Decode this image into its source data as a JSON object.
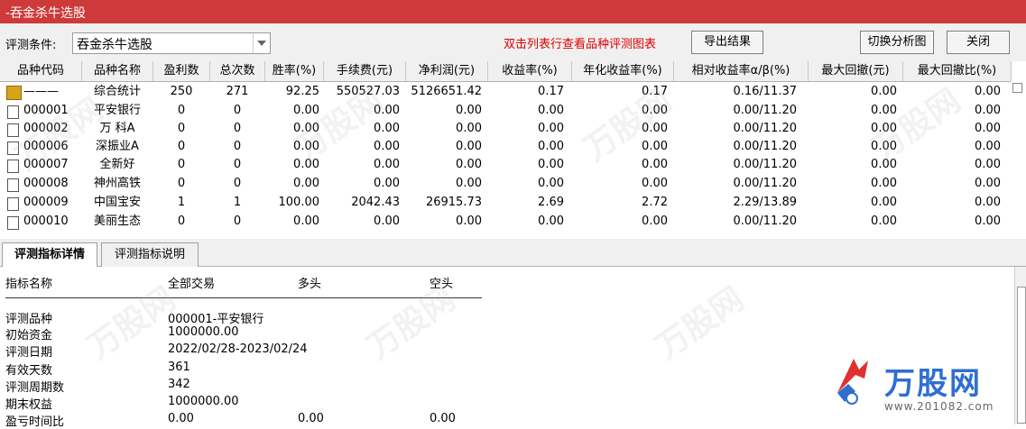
{
  "window": {
    "title": "-吞金杀牛选股"
  },
  "toolbar": {
    "condition_label": "评测条件:",
    "condition_value": "吞金杀牛选股",
    "hint": "双击列表行查看品种评测图表",
    "export_label": "导出结果",
    "switch_label": "切换分析图",
    "close_label": "关闭"
  },
  "table": {
    "headers": [
      "品种代码",
      "品种名称",
      "盈利数",
      "总次数",
      "胜率(%)",
      "手续费(元)",
      "净利润(元)",
      "收益率(%)",
      "年化收益率(%)",
      "相对收益率α/β(%)",
      "最大回撤(元)",
      "最大回撤比(%)"
    ],
    "rows": [
      {
        "code": "———",
        "name": "综合统计",
        "win": "250",
        "total": "271",
        "rate": "92.25",
        "fee": "550527.03",
        "profit": "5126651.42",
        "ret": "0.17",
        "annual": "0.17",
        "rel": "0.16/11.37",
        "dd": "0.00",
        "ddr": "0.00"
      },
      {
        "code": "000001",
        "name": "平安银行",
        "win": "0",
        "total": "0",
        "rate": "0.00",
        "fee": "0.00",
        "profit": "0.00",
        "ret": "0.00",
        "annual": "0.00",
        "rel": "0.00/11.20",
        "dd": "0.00",
        "ddr": "0.00"
      },
      {
        "code": "000002",
        "name": "万 科A",
        "win": "0",
        "total": "0",
        "rate": "0.00",
        "fee": "0.00",
        "profit": "0.00",
        "ret": "0.00",
        "annual": "0.00",
        "rel": "0.00/11.20",
        "dd": "0.00",
        "ddr": "0.00"
      },
      {
        "code": "000006",
        "name": "深振业A",
        "win": "0",
        "total": "0",
        "rate": "0.00",
        "fee": "0.00",
        "profit": "0.00",
        "ret": "0.00",
        "annual": "0.00",
        "rel": "0.00/11.20",
        "dd": "0.00",
        "ddr": "0.00"
      },
      {
        "code": "000007",
        "name": "全新好",
        "win": "0",
        "total": "0",
        "rate": "0.00",
        "fee": "0.00",
        "profit": "0.00",
        "ret": "0.00",
        "annual": "0.00",
        "rel": "0.00/11.20",
        "dd": "0.00",
        "ddr": "0.00"
      },
      {
        "code": "000008",
        "name": "神州高铁",
        "win": "0",
        "total": "0",
        "rate": "0.00",
        "fee": "0.00",
        "profit": "0.00",
        "ret": "0.00",
        "annual": "0.00",
        "rel": "0.00/11.20",
        "dd": "0.00",
        "ddr": "0.00"
      },
      {
        "code": "000009",
        "name": "中国宝安",
        "win": "1",
        "total": "1",
        "rate": "100.00",
        "fee": "2042.43",
        "profit": "26915.73",
        "ret": "2.69",
        "annual": "2.72",
        "rel": "2.29/13.89",
        "dd": "0.00",
        "ddr": "0.00"
      },
      {
        "code": "000010",
        "name": "美丽生态",
        "win": "0",
        "total": "0",
        "rate": "0.00",
        "fee": "0.00",
        "profit": "0.00",
        "ret": "0.00",
        "annual": "0.00",
        "rel": "0.00/11.20",
        "dd": "0.00",
        "ddr": "0.00"
      }
    ]
  },
  "tabs": [
    {
      "label": "评测指标详情",
      "active": true
    },
    {
      "label": "评测指标说明",
      "active": false
    }
  ],
  "detail": {
    "head": {
      "name": "指标名称",
      "all": "全部交易",
      "long": "多头",
      "short": "空头"
    },
    "rows": [
      {
        "label": "评测品种",
        "all": "000001-平安银行",
        "long": "",
        "short": ""
      },
      {
        "label": "初始资金",
        "all": "1000000.00",
        "long": "",
        "short": ""
      },
      {
        "label": "评测日期",
        "all": "2022/02/28-2023/02/24",
        "long": "",
        "short": ""
      },
      {
        "label": "有效天数",
        "all": "361",
        "long": "",
        "short": ""
      },
      {
        "label": "评测周期数",
        "all": "342",
        "long": "",
        "short": ""
      },
      {
        "label": "期末权益",
        "all": "1000000.00",
        "long": "",
        "short": ""
      },
      {
        "label": "盈亏时间比",
        "all": "0.00",
        "long": "0.00",
        "short": "0.00"
      }
    ]
  },
  "watermark": {
    "text": "万股网",
    "url": "www.201082.com"
  },
  "colors": {
    "titlebar": "#ce3a3a",
    "hint": "#e00000",
    "logo_blue": "#2f6fd0",
    "logo_red": "#e0312e"
  }
}
